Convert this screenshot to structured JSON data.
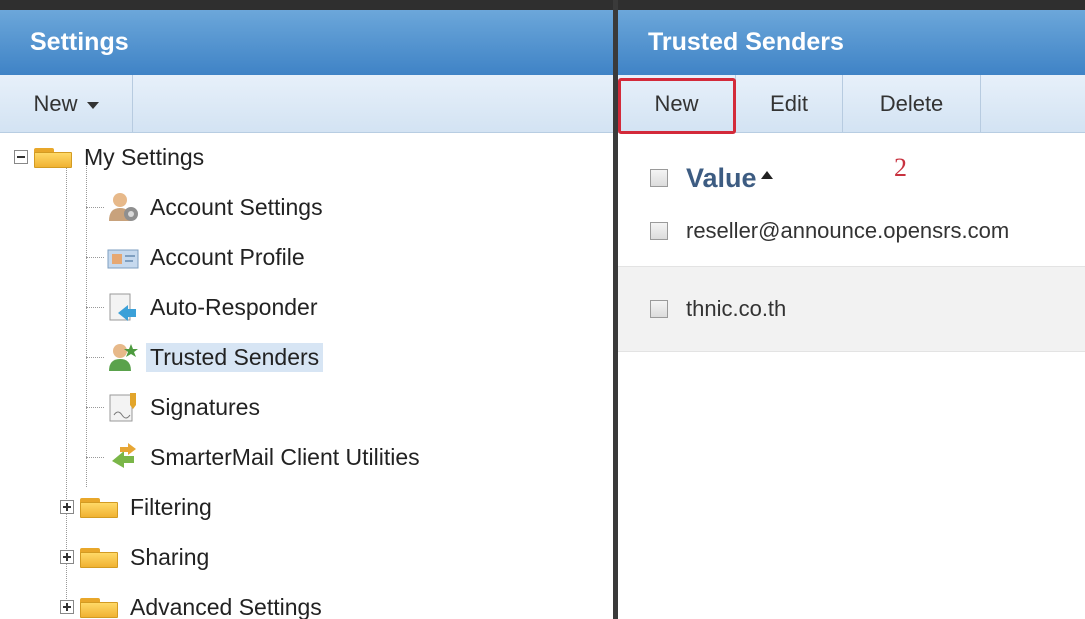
{
  "left": {
    "title": "Settings",
    "toolbar": {
      "new_label": "New"
    },
    "tree": {
      "root": "My Settings",
      "children": [
        "Account Settings",
        "Account Profile",
        "Auto-Responder",
        "Trusted Senders",
        "Signatures",
        "SmarterMail Client Utilities"
      ],
      "folders": [
        "Filtering",
        "Sharing",
        "Advanced Settings"
      ]
    }
  },
  "right": {
    "title": "Trusted Senders",
    "toolbar": {
      "new_label": "New",
      "edit_label": "Edit",
      "delete_label": "Delete"
    },
    "annotation": "2",
    "grid": {
      "column_header": "Value",
      "rows": [
        "reseller@announce.opensrs.com",
        "thnic.co.th"
      ]
    }
  },
  "colors": {
    "title_bar": "#3f83c6",
    "highlight": "#d32a3a",
    "selected": "#d7e5f4"
  }
}
